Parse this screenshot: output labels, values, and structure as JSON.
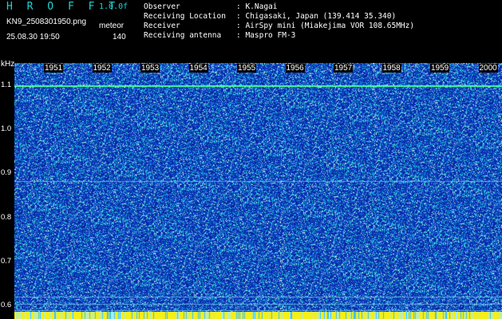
{
  "header": {
    "app_title": "H R O F F T",
    "version": "1.0.0f",
    "filename": "KN9_2508301950.png",
    "meteor_label": "meteor",
    "datetime": "25.08.30 19:50",
    "meteor_count": "140"
  },
  "info": [
    {
      "label": "Observer",
      "value": "K.Nagai"
    },
    {
      "label": "Receiving Location",
      "value": "Chigasaki, Japan (139.414 35.340)"
    },
    {
      "label": "Receiver",
      "value": "AirSpy mini (Miakejima VOR 108.65MHz)"
    },
    {
      "label": "Receiving antenna",
      "value": "Maspro FM-3"
    }
  ],
  "axis": {
    "y_unit": "kHz",
    "y_ticks": [
      "1.1",
      "1.0",
      "0.9",
      "0.8",
      "0.7",
      "0.6"
    ],
    "y_range": [
      0.57,
      1.15
    ],
    "time_ticks": [
      "1951",
      "1952",
      "1953",
      "1954",
      "1955",
      "1956",
      "1957",
      "1958",
      "1959",
      "2000"
    ]
  },
  "colors": {
    "background": "#000000",
    "title": "#1fd3d3",
    "noise_base": "#1228b8",
    "signal_line": "#4dff9a"
  },
  "waterfall": {
    "horizontal_lines_khz": [
      1.1,
      0.883,
      0.62,
      0.605,
      0.59
    ],
    "vertical_streak_minutes": [
      1950.9,
      1955.8,
      1956.9
    ]
  }
}
